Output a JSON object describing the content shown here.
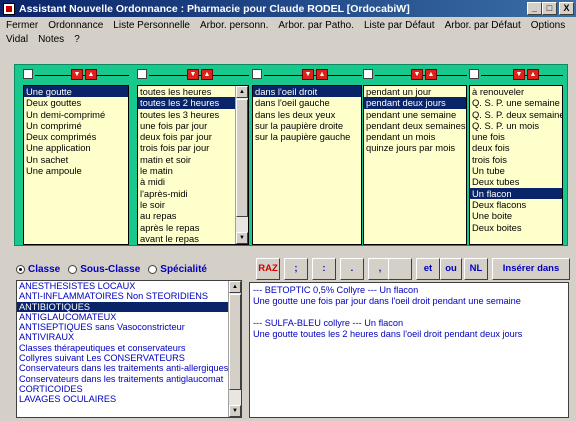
{
  "window": {
    "title": "Assistant Nouvelle Ordonnance : Pharmacie pour Claude RODEL [OrdocabiW]",
    "btn_min": "_",
    "btn_max": "□",
    "btn_close": "X"
  },
  "menu": {
    "row1": [
      "Fermer",
      "Ordonnance",
      "Liste Personnelle",
      "Arbor. personn.",
      "Arbor. par Patho.",
      "Liste par Défaut",
      "Arbor. par Défaut",
      "Options"
    ],
    "row2": [
      "Vidal",
      "Notes",
      "?"
    ]
  },
  "arrows": {
    "down": "▼",
    "up": "▲",
    "scroll_up": "▲",
    "scroll_down": "▼"
  },
  "columns": [
    {
      "items": [
        "Une goutte",
        "Deux gouttes",
        "Un demi-comprimé",
        "Un comprimé",
        "Deux comprimés",
        "Une application",
        "Un sachet",
        "Une ampoule"
      ],
      "selected": 0
    },
    {
      "items": [
        "toutes les heures",
        "toutes les 2 heures",
        "toutes les 3 heures",
        "une fois par jour",
        "deux fois par jour",
        "trois fois par jour",
        "matin et soir",
        "le matin",
        "à midi",
        "l'après-midi",
        "le soir",
        "au repas",
        "après le repas",
        "avant le repas"
      ],
      "selected": 1
    },
    {
      "items": [
        "dans l'oeil droit",
        "dans l'oeil gauche",
        "dans les deux yeux",
        "sur la paupière droite",
        "sur la paupière gauche"
      ],
      "selected": 0
    },
    {
      "items": [
        "pendant un jour",
        "pendant deux jours",
        "pendant une semaine",
        "pendant deux semaines",
        "pendant un mois",
        "quinze jours par mois"
      ],
      "selected": 1
    },
    {
      "items": [
        "à renouveler",
        "Q. S. P. une semaine",
        "Q. S. P. deux semaines",
        "Q. S. P. un mois",
        "une fois",
        "deux fois",
        "trois fois",
        "Un tube",
        "Deux tubes",
        "Un flacon",
        "Deux flacons",
        "Une boite",
        "Deux boites"
      ],
      "selected": 9
    }
  ],
  "radio": {
    "classe": "Classe",
    "sous_classe": "Sous-Classe",
    "specialite": "Spécialité",
    "selected": "classe"
  },
  "classes": {
    "items": [
      "ANESTHESISTES LOCAUX",
      "ANTI-INFLAMMATOIRES Non STEORIDIENS",
      "ANTIBIOTIQUES",
      "ANTIGLAUCOMATEUX",
      "ANTISEPTIQUES sans Vasoconstricteur",
      "ANTIVIRAUX",
      "Classes thérapeutiques et conservateurs",
      "Collyres suivant Les CONSERVATEURS",
      "Conservateurs dans les traitements anti-allergiques",
      "Conservateurs dans les traitements antiglaucomat",
      "CORTICOIDES",
      "LAVAGES OCULAIRES"
    ],
    "selected": 2
  },
  "toolbar": {
    "raz": "RAZ",
    "semicolon": ";",
    "colon": ":",
    "period": ".",
    "comma": ",",
    "blank": "",
    "et": "et",
    "ou": "ou",
    "nl": "NL",
    "insert": "Insérer dans Ord."
  },
  "prescription": {
    "lines": [
      "--- BETOPTIC 0,5% Collyre --- Un flacon",
      "Une goutte une fois par jour dans l'oeil droit pendant une semaine",
      "",
      "--- SULFA-BLEU collyre --- Un flacon",
      "Une goutte toutes les 2 heures dans l'oeil droit pendant deux jours"
    ]
  }
}
